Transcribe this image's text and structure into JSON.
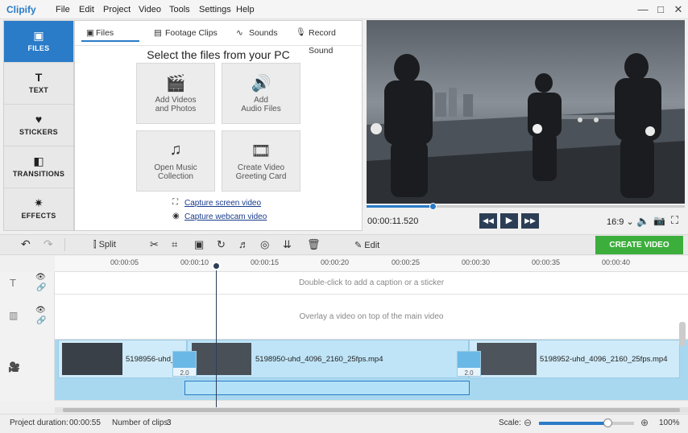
{
  "app": {
    "name": "Clipify"
  },
  "menu": [
    "File",
    "Edit",
    "Project",
    "Video",
    "Tools",
    "Settings",
    "Help"
  ],
  "window": {
    "minimize": "—",
    "maximize": "□",
    "close": "✕"
  },
  "nav": [
    {
      "label": "FILES",
      "icon": "▣"
    },
    {
      "label": "TEXT",
      "icon": "T"
    },
    {
      "label": "STICKERS",
      "icon": "♥"
    },
    {
      "label": "TRANSITIONS",
      "icon": "◧"
    },
    {
      "label": "EFFECTS",
      "icon": "✷"
    }
  ],
  "tabs": [
    {
      "label": "Files",
      "icon": "▣"
    },
    {
      "label": "Footage Clips",
      "icon": "▤"
    },
    {
      "label": "Sounds",
      "icon": "∿"
    },
    {
      "label": "Record Sound",
      "icon": "🎙"
    }
  ],
  "files_panel": {
    "heading": "Select the files from your PC",
    "tiles": [
      {
        "line1": "Add Videos",
        "line2": "and Photos",
        "icon": "🎬"
      },
      {
        "line1": "Add",
        "line2": "Audio Files",
        "icon": "🔊"
      },
      {
        "line1": "Open Music",
        "line2": "Collection",
        "icon": "♫"
      },
      {
        "line1": "Create Video",
        "line2": "Greeting Card",
        "icon": "🎞"
      }
    ],
    "capture_screen": "Capture screen video",
    "capture_webcam": "Capture webcam video"
  },
  "player": {
    "timecode": "00:00:11.520",
    "progress": 0.21,
    "aspect": "16:9 ⌄",
    "prev": "◀◀",
    "play": "▶",
    "next": "▶▶"
  },
  "toolbar": {
    "undo": "↶",
    "redo": "↷",
    "split": "Split",
    "edit": "Edit",
    "create": "CREATE VIDEO"
  },
  "ruler": [
    "00:00:05",
    "00:00:10",
    "00:00:15",
    "00:00:20",
    "00:00:25",
    "00:00:30",
    "00:00:35",
    "00:00:40"
  ],
  "tracks": {
    "caption_hint": "Double-click to add a caption or a sticker",
    "overlay_hint": "Overlay a video on top of the main video"
  },
  "clips": [
    {
      "name": "5198956-uhd_"
    },
    {
      "name": "5198950-uhd_4096_2160_25fps.mp4"
    },
    {
      "name": "5198952-uhd_4096_2160_25fps.mp4"
    }
  ],
  "transitions": [
    "2.0",
    "2.0"
  ],
  "status": {
    "duration_label": "Project duration:",
    "duration": "00:00:55",
    "clips_label": "Number of clips:",
    "clips": "3",
    "scale_label": "Scale:",
    "scale": "100%",
    "scale_level": 0.72
  }
}
